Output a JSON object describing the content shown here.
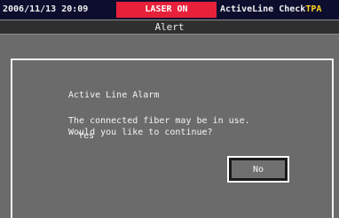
{
  "status_bar": {
    "datetime": "2006/11/13 20:09",
    "laser_status": "LASER ON",
    "check_name": "ActiveLine Check",
    "check_tag": "TPA"
  },
  "title_bar": {
    "title": "Alert"
  },
  "dialog": {
    "heading": "Active Line Alarm",
    "message_line1": "The connected fiber may be in use.",
    "message_line2": "Would you like to continue?",
    "yes_label": "Yes",
    "no_label": "No"
  },
  "colors": {
    "status_bar_bg": "#0d0d2e",
    "laser_badge": "#e8213a",
    "tag_text": "#ffd21f",
    "panel_bg": "#6b6b6b"
  }
}
